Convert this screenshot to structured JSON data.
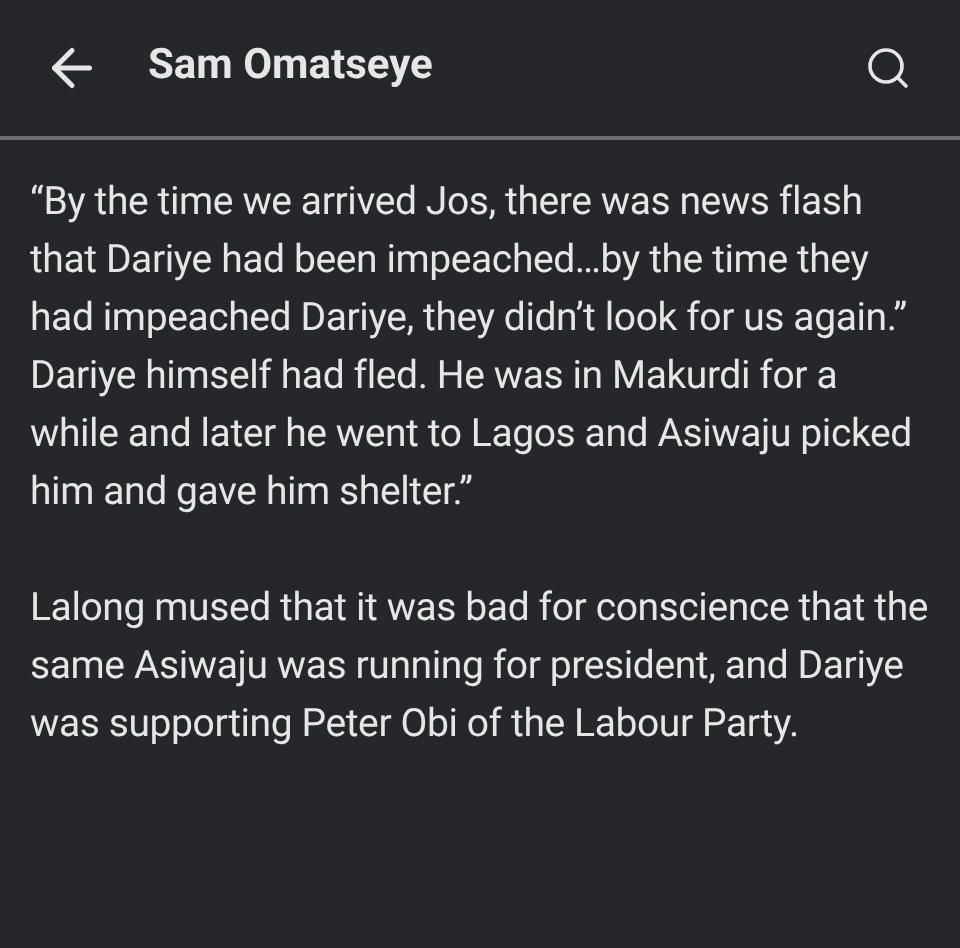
{
  "header": {
    "title": "Sam Omatseye"
  },
  "paragraphs": [
    "“By the time we arrived Jos, there was news flash that Dariye had been impeached…by the time they had impeached Dariye, they didn’t look for us again.” Dariye himself had fled. He was in Makurdi for a while and later he went to Lagos and Asiwaju picked him and gave him shelter.”",
    "Lalong mused that it was bad for conscience that the same Asiwaju was running for president, and Dariye was supporting Peter Obi of the Labour Party."
  ]
}
